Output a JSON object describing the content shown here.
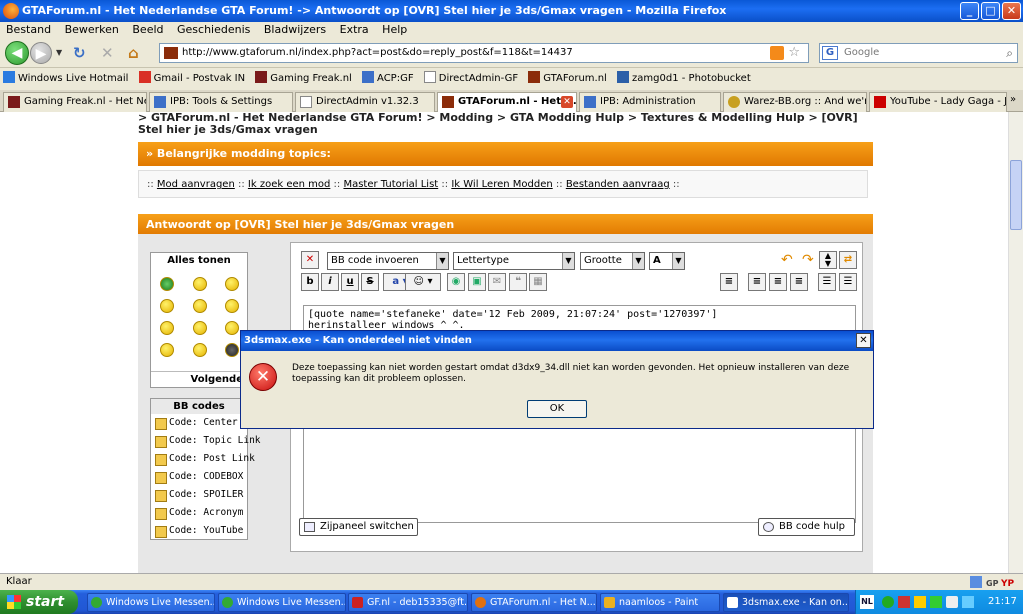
{
  "window": {
    "title": "GTAForum.nl - Het Nederlandse GTA Forum! -> Antwoordt op [OVR] Stel hier je 3ds/Gmax vragen - Mozilla Firefox"
  },
  "menu": [
    "Bestand",
    "Bewerken",
    "Beeld",
    "Geschiedenis",
    "Bladwijzers",
    "Extra",
    "Help"
  ],
  "nav": {
    "url": "http://www.gtaforum.nl/index.php?act=post&do=reply_post&f=118&t=14437",
    "search_placeholder": "Google"
  },
  "bookmarks": [
    "Windows Live Hotmail",
    "Gmail - Postvak IN",
    "Gaming Freak.nl",
    "ACP:GF",
    "DirectAdmin-GF",
    "GTAForum.nl",
    "zamg0d1 - Photobucket"
  ],
  "tabs": [
    "Gaming Freak.nl - Het Ne...",
    "IPB: Tools & Settings",
    "DirectAdmin v1.32.3",
    "GTAForum.nl - Het N...",
    "IPB: Administration",
    "Warez-BB.org :: And we'r...",
    "YouTube - Lady Gaga - J..."
  ],
  "page": {
    "breadcrumb": "> GTAForum.nl - Het Nederlandse GTA Forum! > Modding > GTA Modding Hulp > Textures & Modelling Hulp > [OVR] Stel hier je 3ds/Gmax vragen",
    "important_header": "» Belangrijke modding topics:",
    "quicklinks": [
      "Mod aanvragen",
      "Ik zoek een mod",
      "Master Tutorial List",
      "Ik Wil Leren Modden",
      "Bestanden aanvraag"
    ],
    "reply_header": "Antwoordt op [OVR] Stel hier je 3ds/Gmax vragen",
    "emoticons_header": "Alles tonen",
    "emoticons_next": "Volgende",
    "bbcodes_header": "BB codes",
    "bbcodes": [
      "Code: Center",
      "Code: Topic Link",
      "Code: Post Link",
      "Code: CODEBOX",
      "Code: SPOILER",
      "Code: Acronym",
      "Code: YouTube"
    ],
    "bbcode_select": "BB code invoeren",
    "font_select": "Lettertype",
    "size_select": "Grootte",
    "color_select": "A",
    "editor_text": "[quote name='stefaneke' date='12 Feb 2009, 21:07:24' post='1270397']\nherinstalleer windows ^_^.",
    "side_toggle": "Zijpaneel switchen",
    "bb_help": "BB code hulp"
  },
  "dialog": {
    "title": "3dsmax.exe - Kan onderdeel niet vinden",
    "message": "Deze toepassing kan niet worden gestart omdat d3dx9_34.dll niet kan worden gevonden. Het opnieuw installeren van deze toepassing kan dit probleem oplossen.",
    "ok": "OK"
  },
  "status": "Klaar",
  "taskbar": {
    "start": "start",
    "tasks": [
      "Windows Live Messen...",
      "Windows Live Messen...",
      "GF.nl - deb15335@ft...",
      "GTAForum.nl - Het N...",
      "naamloos - Paint",
      "3dsmax.exe - Kan on..."
    ],
    "clock": "21:17",
    "lang": "NL"
  }
}
